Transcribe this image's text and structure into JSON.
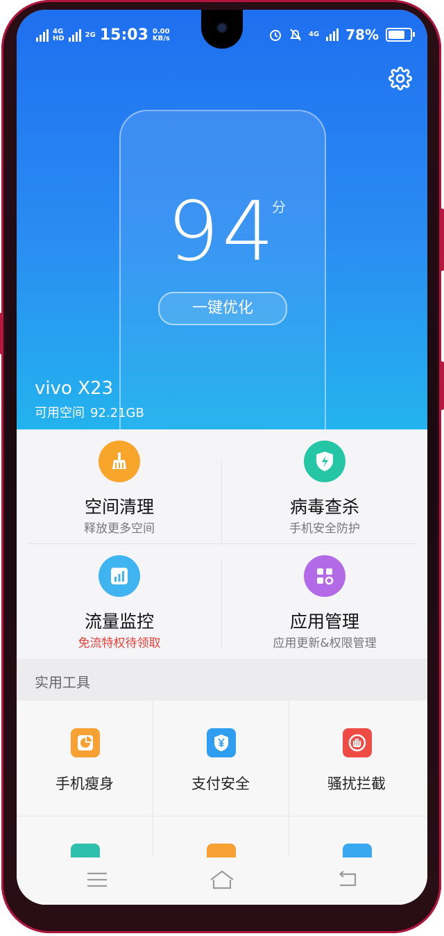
{
  "status_bar": {
    "sim1": "4G",
    "sim1_tag": "HD",
    "sim2": "2G",
    "time": "15:03",
    "net_speed_value": "0.00",
    "net_speed_unit": "KB/s",
    "sim_right": "4G",
    "battery": "78%",
    "battery_level": 0.78
  },
  "hero": {
    "score": "94",
    "score_unit": "分",
    "optimize_label": "一键优化",
    "device_name": "vivo X23",
    "storage_label": "可用空间",
    "storage_value": "92.21GB"
  },
  "features": [
    {
      "title": "空间清理",
      "subtitle": "释放更多空间",
      "icon": "broom-icon",
      "color": "#f7a52b"
    },
    {
      "title": "病毒查杀",
      "subtitle": "手机安全防护",
      "icon": "shield-bolt-icon",
      "color": "#25c6a6"
    },
    {
      "title": "流量监控",
      "subtitle": "免流特权待领取",
      "icon": "bar-chart-icon",
      "color": "#3fb4f0"
    },
    {
      "title": "应用管理",
      "subtitle": "应用更新&权限管理",
      "icon": "app-grid-icon",
      "color": "#b36ae6"
    }
  ],
  "tools_section": {
    "title": "实用工具",
    "items": [
      {
        "label": "手机瘦身",
        "icon": "pie-chart-icon",
        "color": "#f7a033"
      },
      {
        "label": "支付安全",
        "icon": "yuan-shield-icon",
        "color": "#2f9ef0"
      },
      {
        "label": "骚扰拦截",
        "icon": "block-hand-icon",
        "color": "#ee4b45"
      }
    ],
    "partial_colors": [
      "#2fc0ad",
      "#f7a033",
      "#3aa8f0"
    ]
  },
  "colors": {
    "hero_top": "#1f6ff0",
    "hero_bottom": "#23b3ee",
    "frame_accent": "#b1163f",
    "warning_text": "#e5403a"
  }
}
